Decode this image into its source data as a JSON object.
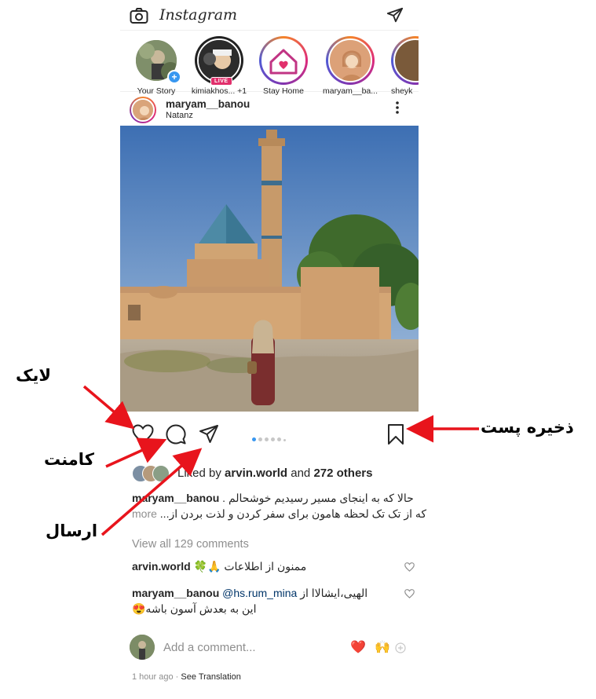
{
  "app": {
    "title": "Instagram"
  },
  "header": {
    "brand": "Instagram",
    "left_icon": "camera-icon",
    "right_icon": "direct-message-icon"
  },
  "stories": [
    {
      "label": "Your Story"
    },
    {
      "label": "kimiakhos... +1",
      "badge": "LIVE"
    },
    {
      "label": "Stay Home"
    },
    {
      "label": "maryam__ba..."
    },
    {
      "label": "sheyk"
    }
  ],
  "post": {
    "username": "maryam__banou",
    "location": "Natanz",
    "menu_icon": "more-vertical-icon",
    "carousel": {
      "count": 6,
      "active": 1
    },
    "likes": {
      "prefix": "Liked by",
      "user": "arvin.world",
      "middle": "and",
      "others": "272 others"
    },
    "caption": {
      "username": "maryam__banou",
      "line1": "حالا که به اینجای مسیر رسیدیم خوشحالم .",
      "line2": "که از تک تک لحظه هامون برای سفر کردن و لذت بردن از...",
      "more": "more"
    },
    "view_all": "View all 129 comments",
    "comments": [
      {
        "username": "arvin.world",
        "text": "ممنون از اطلاعات 🙏🍀"
      },
      {
        "username": "maryam__banou",
        "mention": "@hs.rum_mina",
        "text1": "الهیی،ایشالاا از",
        "text2": "این به بعدش آسون باشه😍"
      }
    ],
    "add_comment": {
      "placeholder": "Add a comment...",
      "emojis": [
        "❤️",
        "🙌"
      ]
    },
    "time": "1 hour ago",
    "see_translation": "See Translation"
  },
  "annotations": {
    "like": "لایک",
    "comment": "کامنت",
    "send": "ارسال",
    "save": "ذخیره پست"
  },
  "colors": {
    "arrow": "#e8141c",
    "link": "#003569",
    "accent": "#3897f0",
    "muted": "#8e8e8e"
  }
}
